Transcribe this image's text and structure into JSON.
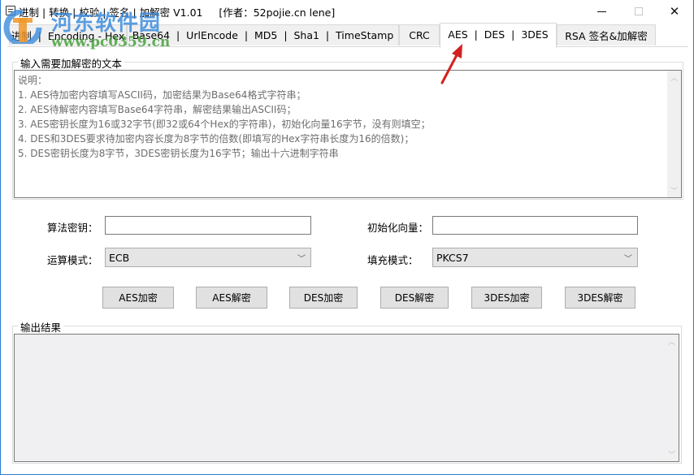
{
  "window": {
    "title": "进制 | 转换 | 校验 | 签名 | 加解密 V1.01     [作者：52pojie.cn lene]",
    "controls": {
      "minimize": "minimize",
      "maximize": "maximize",
      "close": "close"
    }
  },
  "tabs": [
    {
      "label": "进制  |  Encoding - Hex",
      "active": false
    },
    {
      "label": "Base64  |  UrlEncode  |  MD5  |  Sha1  |  TimeStamp",
      "active": false
    },
    {
      "label": "CRC",
      "active": false
    },
    {
      "label": "AES  |  DES  |  3DES",
      "active": true
    },
    {
      "label": "RSA 签名&加解密",
      "active": false
    }
  ],
  "input_group": {
    "legend": "输入需要加解密的文本",
    "text_lines": [
      "说明：",
      "1. AES待加密内容填写ASCII码，加密结果为Base64格式字符串；",
      "2. AES待解密内容填写Base64字符串，解密结果输出ASCII码；",
      "3. AES密钥长度为16或32字节(即32或64个Hex的字符串)，初始化向量16字节，没有则填空；",
      "4. DES和3DES要求待加密内容长度为8字节的倍数(即填写的Hex字符串长度为16的倍数)；",
      "5. DES密钥长度为8字节，3DES密钥长度为16字节；输出十六进制字符串"
    ]
  },
  "form": {
    "key_label": "算法密钥：",
    "key_value": "",
    "iv_label": "初始化向量：",
    "iv_value": "",
    "mode_label": "运算模式：",
    "mode_value": "ECB",
    "padding_label": "填充模式：",
    "padding_value": "PKCS7"
  },
  "buttons": [
    {
      "label": "AES加密"
    },
    {
      "label": "AES解密"
    },
    {
      "label": "DES加密"
    },
    {
      "label": "DES解密"
    },
    {
      "label": "3DES加密"
    },
    {
      "label": "3DES解密"
    }
  ],
  "output_group": {
    "legend": "输出结果",
    "value": ""
  },
  "watermark": {
    "cn_text": "河东软件园",
    "url_text": "www.pc0359.cn"
  },
  "colors": {
    "window_border": "#2b7bd0",
    "arrow": "#d42020"
  }
}
